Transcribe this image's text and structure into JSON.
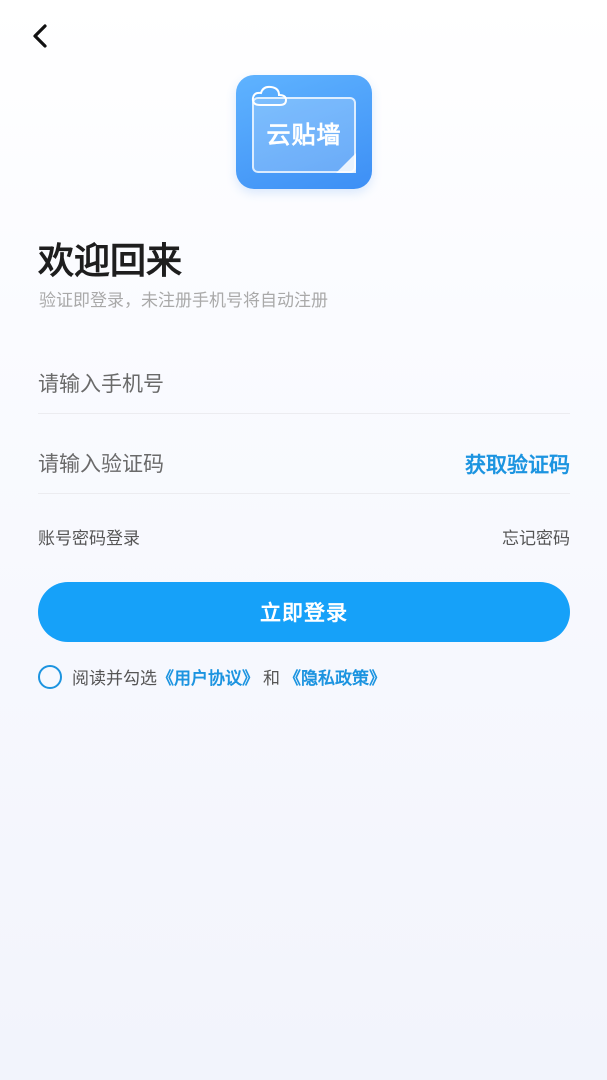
{
  "nav": {
    "back_icon": "chevron-left-icon"
  },
  "logo": {
    "text": "云贴墙",
    "icon": "cloud-note-icon",
    "color": "#4a9ff8"
  },
  "welcome": {
    "title": "欢迎回来",
    "subtitle": "验证即登录，未注册手机号将自动注册"
  },
  "form": {
    "phone_placeholder": "请输入手机号",
    "code_placeholder": "请输入验证码",
    "get_code_label": "获取验证码"
  },
  "links": {
    "password_login": "账号密码登录",
    "forgot_password": "忘记密码"
  },
  "login_button": {
    "label": "立即登录",
    "color": "#16a1f9"
  },
  "agreement": {
    "prefix": "阅读并勾选",
    "user_agreement": "《用户协议》",
    "and": "和",
    "privacy_policy": "《隐私政策》",
    "checked": false
  }
}
